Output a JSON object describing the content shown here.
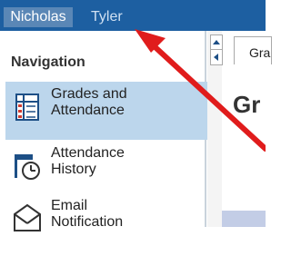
{
  "header": {
    "user_first": "Nicholas",
    "user_last": "Tyler"
  },
  "sidebar": {
    "heading": "Navigation",
    "items": [
      {
        "label_line1": "Grades and",
        "label_line2": "Attendance",
        "icon": "gradebook-icon",
        "active": true
      },
      {
        "label_line1": "Attendance",
        "label_line2": "History",
        "icon": "attendance-history-icon",
        "active": false
      },
      {
        "label_line1": "Email",
        "label_line2": "Notification",
        "icon": "email-icon",
        "active": false
      }
    ]
  },
  "main": {
    "tab_label": "Gra",
    "title_partial": "Gr"
  },
  "colors": {
    "header_bg": "#1d5fa1",
    "active_item_bg": "#bcd6ec",
    "arrow": "#e01c1c"
  }
}
